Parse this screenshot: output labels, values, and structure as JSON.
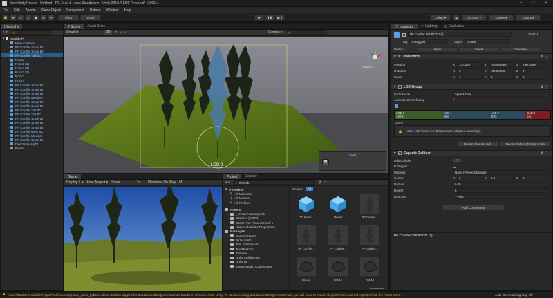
{
  "window": {
    "title": "New Unity Project - Untitled - PC, Mac & Linux Standalone - Unity 2019.4.13f1 Personal* <DX11>",
    "controls": [
      "–",
      "□",
      "✕"
    ]
  },
  "menu": [
    "File",
    "Edit",
    "Assets",
    "GameObject",
    "Component",
    "Octane",
    "Window",
    "Help"
  ],
  "toolbar": {
    "tools": [
      "✋",
      "✥",
      "⟳",
      "⤢",
      "▣",
      "⊕",
      "✳"
    ],
    "pivot_label": "Pivot",
    "local_label": "Local",
    "play_controls": [
      "▶",
      "❚❚",
      "▶❚"
    ],
    "collab_label": "Collab ▾",
    "account_label": "Account ▾",
    "layers_label": "Layers ▾",
    "layout_label": "Layout ▾"
  },
  "hierarchy": {
    "tab": "Hierarchy",
    "search_placeholder": "All",
    "add": "+ ▾",
    "scene": "Untitled*",
    "items": [
      {
        "label": "Main Camera",
        "indent": 2,
        "kind": "gray"
      },
      {
        "label": "PF Conifer Small Br",
        "indent": 2,
        "kind": "blue"
      },
      {
        "label": "PF Conifer Small Br",
        "indent": 2,
        "kind": "blue"
      },
      {
        "label": "PF Conifer Tall BO",
        "indent": 2,
        "kind": "blue",
        "selected": true
      },
      {
        "label": "Rock2",
        "indent": 2,
        "kind": "blue"
      },
      {
        "label": "Rock2 (1)",
        "indent": 2,
        "kind": "blue"
      },
      {
        "label": "Rock4 (2)",
        "indent": 2,
        "kind": "blue"
      },
      {
        "label": "Rock3 (1)",
        "indent": 2,
        "kind": "blue"
      },
      {
        "label": "Rock3",
        "indent": 2,
        "kind": "blue"
      },
      {
        "label": "Rock4",
        "indent": 2,
        "kind": "blue"
      },
      {
        "label": "PF Conifer Small Br",
        "indent": 2,
        "kind": "blue"
      },
      {
        "label": "PF Conifer Small Br",
        "indent": 2,
        "kind": "blue"
      },
      {
        "label": "PF Conifer Small Br",
        "indent": 2,
        "kind": "blue"
      },
      {
        "label": "PF Conifer Medium",
        "indent": 2,
        "kind": "blue"
      },
      {
        "label": "PF Conifer Small Br",
        "indent": 2,
        "kind": "blue"
      },
      {
        "label": "PF Conifer Small Br",
        "indent": 2,
        "kind": "blue"
      },
      {
        "label": "PF Conifer Tall BO",
        "indent": 2,
        "kind": "blue"
      },
      {
        "label": "PF Conifer Tall BO",
        "indent": 2,
        "kind": "blue"
      },
      {
        "label": "PF Conifer Small Br",
        "indent": 2,
        "kind": "blue"
      },
      {
        "label": "PF Conifer Small Br",
        "indent": 2,
        "kind": "blue"
      },
      {
        "label": "PF Conifer Small Br",
        "indent": 2,
        "kind": "blue"
      },
      {
        "label": "PF Conifer Bare BC",
        "indent": 2,
        "kind": "blue"
      },
      {
        "label": "PF Conifer Medium",
        "indent": 2,
        "kind": "blue"
      },
      {
        "label": "PF Conifer Small Br",
        "indent": 2,
        "kind": "blue"
      },
      {
        "label": "Directional Light",
        "indent": 2,
        "kind": "gray"
      },
      {
        "label": "Plane",
        "indent": 2,
        "kind": "gray"
      }
    ]
  },
  "scene_view": {
    "tabs": [
      "# Scene",
      "Asset Store"
    ],
    "shading": "Shaded",
    "mode_2d": "2D",
    "gizmos": "Gizmos ▾",
    "search": "All",
    "persp": "< Persp",
    "lod_label": "LOD 0",
    "tools_label": "Tools"
  },
  "game_view": {
    "tab": "Game",
    "display": "Display 1 ▾",
    "aspect": "Free Aspect ▾",
    "scale_label": "Scale",
    "scale_value": "1x",
    "maximize": "Maximize On Play",
    "mute": "M"
  },
  "project": {
    "tabs": [
      "Project",
      "Console"
    ],
    "add": "+ ▾",
    "breadcrumb": "< HPrefab",
    "search_label": "Search:",
    "search_scope": "All",
    "favorites_label": "Favorites",
    "favorites": [
      "All Materials",
      "All Models",
      "All Prefabs"
    ],
    "assets_label": "Assets",
    "asset_folders": [
      "_TerrainAutoUpgrade",
      "Conifers [BOTD]",
      "Grass And Flowers Pack 1",
      "Nature Realistic Props Pack"
    ],
    "packages_label": "Packages",
    "package_folders": [
      "Custom NUnit",
      "Rider Editor",
      "Test Framework",
      "TextMeshPro",
      "Timeline",
      "Unity Collaborate",
      "Unity UI",
      "Visual Studio Code Editor"
    ],
    "grid": [
      {
        "label": "CTI Micro...",
        "thumb": "cube"
      },
      {
        "label": "Flower",
        "thumb": "cube"
      },
      {
        "label": "PF Conifer...",
        "thumb": "tree"
      },
      {
        "label": "PF Conifer...",
        "thumb": "tree"
      },
      {
        "label": "PF Conifer...",
        "thumb": "tree"
      },
      {
        "label": "PF Conifer...",
        "thumb": "tree"
      },
      {
        "label": "Rock1",
        "thumb": "rock"
      },
      {
        "label": "Rock2",
        "thumb": "rock"
      },
      {
        "label": "Rock3",
        "thumb": "rock"
      }
    ]
  },
  "inspector": {
    "tabs": [
      "Inspector",
      "Lighting",
      "Occlusion"
    ],
    "object_name": "PF Conifer Tall BOTD (2)",
    "static_label": "Static ▾",
    "tag_label": "Tag",
    "tag_value": "Untagged",
    "layer_label": "Layer",
    "layer_value": "Default",
    "prefab_label": "Prefab",
    "prefab_open": "Open",
    "prefab_select": "Select",
    "prefab_overrides": "Overrides",
    "transform": {
      "title": "Transform",
      "rows": [
        {
          "label": "Position",
          "x": "13.00207",
          "y": "-3.543358e",
          "z": "6.976299"
        },
        {
          "label": "Rotation",
          "x": "0",
          "y": "-89.08501",
          "z": "0"
        },
        {
          "label": "Scale",
          "x": "1",
          "y": "1",
          "z": "1"
        }
      ]
    },
    "lod_group": {
      "title": "LOD Group",
      "fade_mode_label": "Fade Mode",
      "fade_mode_value": "Speed Tree",
      "animate_label": "Animate Cross-fading",
      "animate_value": "✓",
      "bars": [
        {
          "label": "LOD 0",
          "pct": "100%",
          "color": "#3c5e26",
          "fraction": 0.31
        },
        {
          "label": "LOD 1",
          "pct": "60%",
          "color": "#2d4a5a",
          "fraction": 0.31
        },
        {
          "label": "LOD 2",
          "pct": "30%",
          "color": "#2c4a5e",
          "fraction": 0.23
        },
        {
          "label": "Culled",
          "pct": "5%",
          "color": "#7a1e1e",
          "fraction": 0.15
        }
      ],
      "marker": "100%",
      "warning": "Active LOD bias is 2.0. Distances are adjusted accordingly.",
      "recalc_bounds": "Recalculate Bounds",
      "recalc_lightmap": "Recalculate Lightmap Scale"
    },
    "capsule": {
      "title": "Capsule Collider",
      "edit_label": "Edit Collider",
      "trigger_label": "Is Trigger",
      "material_label": "Material",
      "material_value": "None (Physic Material)",
      "center_label": "Center",
      "center_x": "0",
      "center_y": "2.5",
      "center_z": "0",
      "radius_label": "Radius",
      "radius_value": "0.25",
      "height_label": "Height",
      "height_value": "6",
      "direction_label": "Direction",
      "direction_value": "Y-Axis"
    },
    "add_component": "Add Component",
    "footer_name": "PF Conifer Tall BOTD (2)"
  },
  "status": {
    "message": "Assets/Nature Realistic Props Pack/Source/ground_main_pebbles.sbsar: Built-in support for Substance Designer materials has been removed from Unity. To continue using Substance Designer materials, you will need to install Allegorithmic's external importer from the Asset Store.",
    "right": "Auto Generate Lighting Off"
  },
  "colors": {
    "accent": "#3a79bb",
    "selected_row": "#2c5d87",
    "warning": "#e2b12a"
  }
}
